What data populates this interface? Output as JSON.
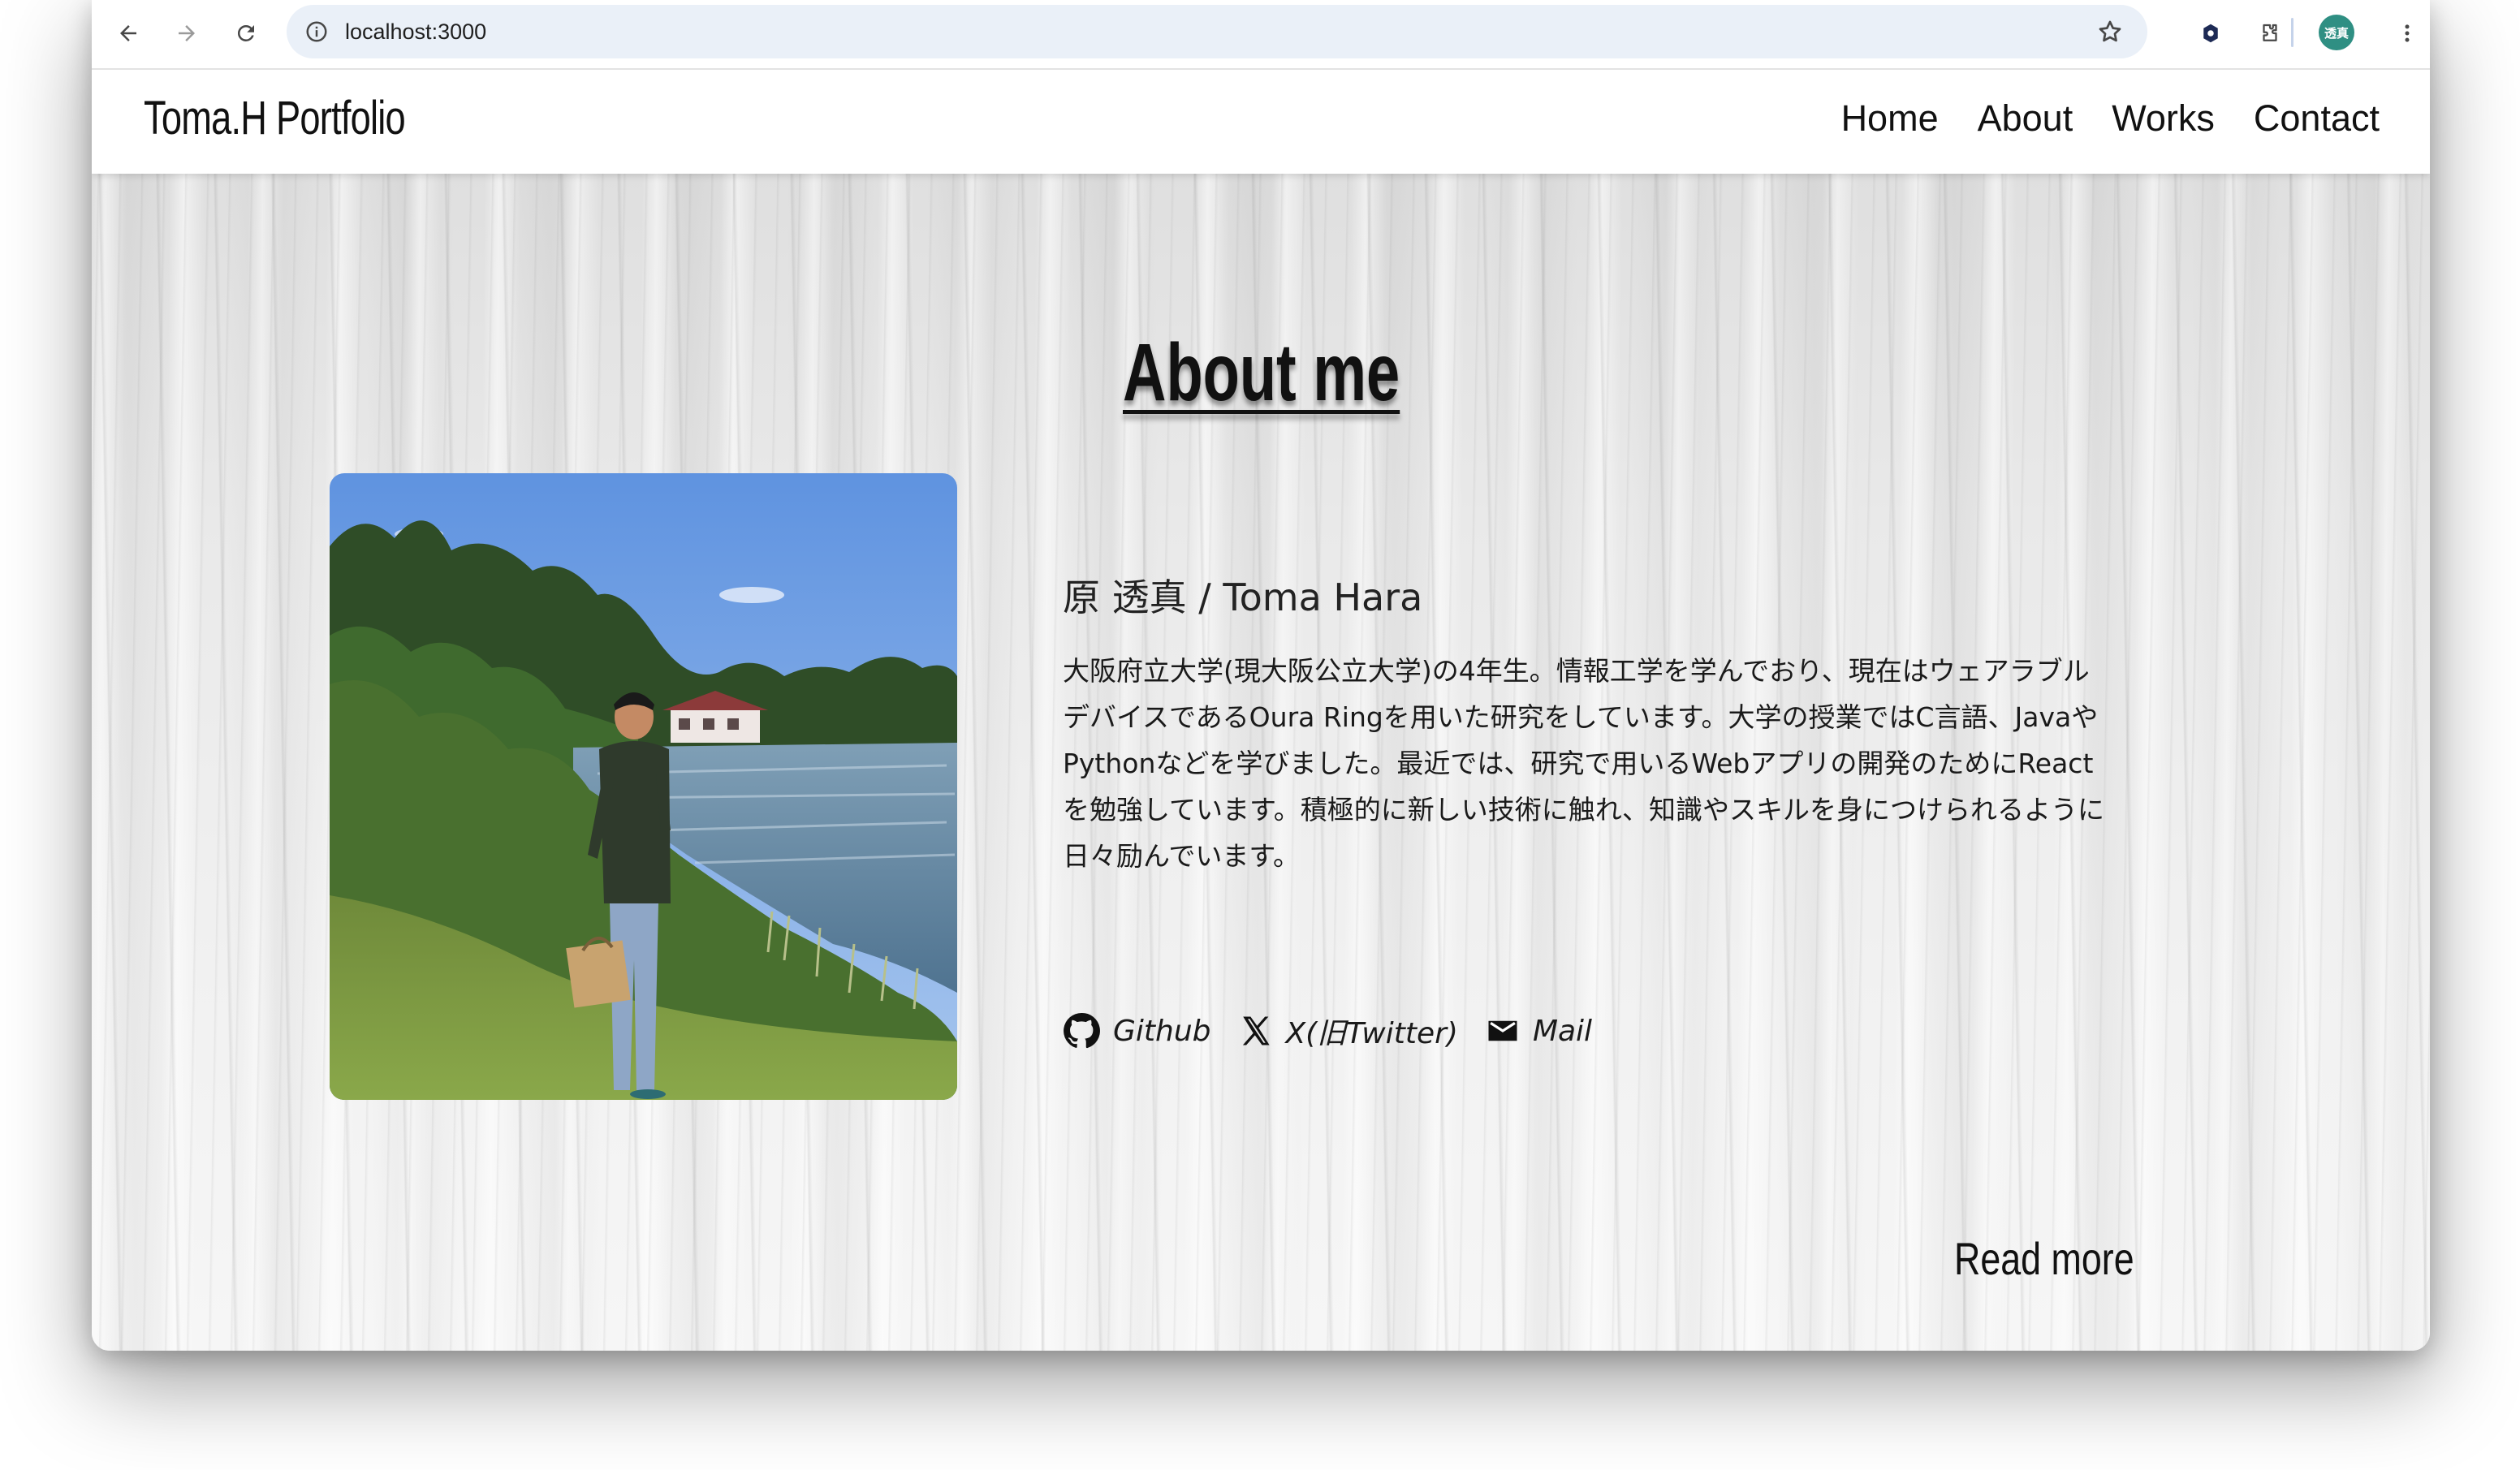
{
  "browser": {
    "url": "localhost:3000",
    "profile_initials": "透真",
    "icons": {
      "back": "arrow-left-icon",
      "forward": "arrow-right-icon",
      "reload": "reload-icon",
      "site_info": "info-icon",
      "bookmark": "star-icon",
      "extension_shield": "shield-extension-icon",
      "extensions": "puzzle-icon",
      "menu": "three-dots-icon"
    }
  },
  "site": {
    "logo": "Toma.H Portfolio",
    "nav": [
      {
        "label": "Home"
      },
      {
        "label": "About"
      },
      {
        "label": "Works"
      },
      {
        "label": "Contact"
      }
    ]
  },
  "about": {
    "heading": "About me",
    "name": "原 透真 / Toma Hara",
    "bio_lines": [
      "大阪府立大学(現大阪公立大学)の4年生。情報工学を学んでおり、現在はウェアラブル",
      "デバイスであるOura Ringを用いた研究をしています。大学の授業ではC言語、Javaや",
      "Pythonなどを学びました。最近では、研究で用いるWebアプリの開発のためにReact",
      "を勉強しています。積極的に新しい技術に触れ、知識やスキルを身につけられるように",
      "日々励んでいます。"
    ],
    "links": [
      {
        "label": "Github",
        "icon": "github-icon"
      },
      {
        "label": "X(旧Twitter)",
        "icon": "x-logo-icon"
      },
      {
        "label": "Mail",
        "icon": "mail-icon"
      }
    ],
    "read_more": "Read more"
  },
  "colors": {
    "accent_text": "#111111",
    "omnibox_bg": "#eaf0f8",
    "avatar_bg": "#2f8f83"
  }
}
